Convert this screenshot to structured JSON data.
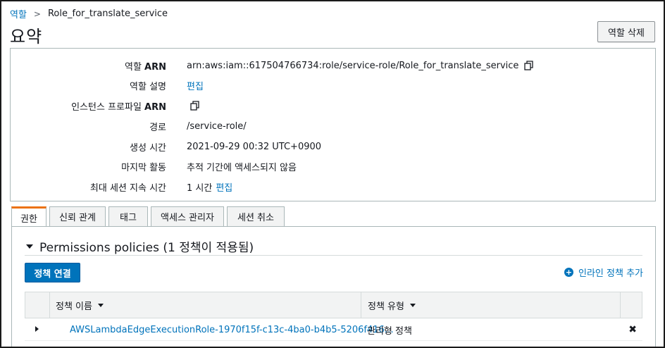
{
  "breadcrumb": {
    "parent": "역할",
    "separator": ">",
    "current": "Role_for_translate_service"
  },
  "page": {
    "title": "요약",
    "delete_button": "역할 삭제"
  },
  "summary": {
    "role_arn": {
      "label_prefix": "역할 ",
      "label_bold": "ARN",
      "value": "arn:aws:iam::617504766734:role/service-role/Role_for_translate_service"
    },
    "description": {
      "label": "역할 설명",
      "value": "편집"
    },
    "instance_profile": {
      "label_prefix": "인스턴스 프로파일 ",
      "label_bold": "ARN"
    },
    "path": {
      "label": "경로",
      "value": "/service-role/"
    },
    "created": {
      "label": "생성 시간",
      "value": "2021-09-29 00:32 UTC+0900"
    },
    "last_activity": {
      "label": "마지막 활동",
      "value": "추적 기간에 액세스되지 않음"
    },
    "max_session": {
      "label": "최대 세션 지속 시간",
      "value": "1 시간",
      "edit_link": "편집"
    }
  },
  "tabs": [
    {
      "label": "권한",
      "active": true
    },
    {
      "label": "신뢰 관계",
      "active": false
    },
    {
      "label": "태그",
      "active": false
    },
    {
      "label": "액세스 관리자",
      "active": false
    },
    {
      "label": "세션 취소",
      "active": false
    }
  ],
  "permissions": {
    "section_title": "Permissions policies (1 정책이 적용됨)",
    "attach_button": "정책 연결",
    "inline_add": "인라인 정책 추가",
    "columns": {
      "name": "정책 이름",
      "type": "정책 유형"
    },
    "rows": [
      {
        "name": "AWSLambdaEdgeExecutionRole-1970f15f-c13c-4ba0-b4b5-5206f416…",
        "type": "관리형 정책"
      }
    ]
  },
  "colors": {
    "link": "#0073bb",
    "primary_button": "#0073bb",
    "active_tab_accent": "#ec7211",
    "border": "#aab7b8"
  },
  "icons": [
    "copy-icon",
    "plus-circle-icon",
    "caret-down-icon",
    "caret-right-icon",
    "close-icon"
  ]
}
